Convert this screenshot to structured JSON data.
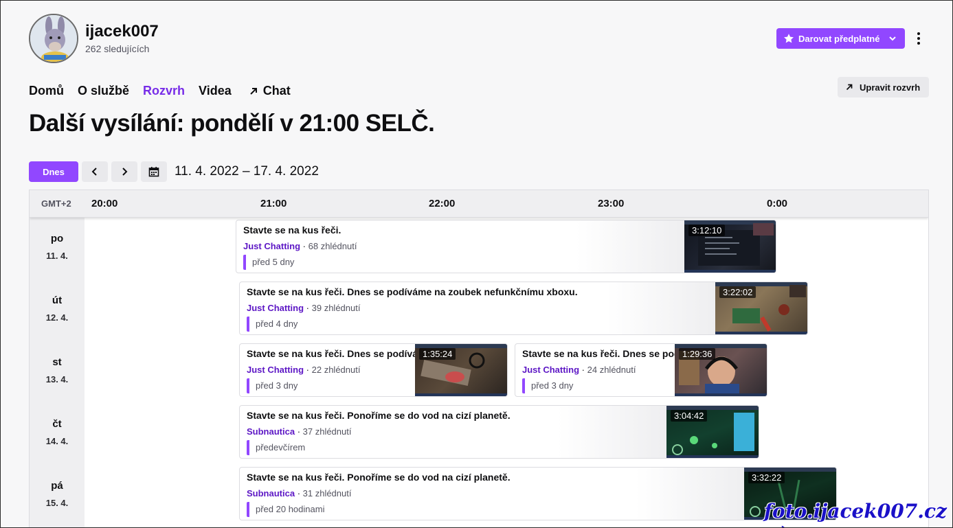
{
  "channel": {
    "name": "ijacek007",
    "followers": "262 sledujících"
  },
  "header": {
    "gift_label": "Darovat předplatné",
    "edit_label": "Upravit rozvrh"
  },
  "nav": {
    "home": "Domů",
    "about": "O službě",
    "schedule": "Rozvrh",
    "videos": "Videa",
    "chat": "Chat"
  },
  "headline": "Další vysílání: pondělí v 21:00 SELČ.",
  "controls": {
    "today": "Dnes",
    "range": "11. 4. 2022 – 17. 4. 2022"
  },
  "grid": {
    "tz": "GMT+2",
    "hours": [
      "20:00",
      "21:00",
      "22:00",
      "23:00",
      "0:00"
    ],
    "days": [
      {
        "name": "po",
        "date": "11. 4."
      },
      {
        "name": "út",
        "date": "12. 4."
      },
      {
        "name": "st",
        "date": "13. 4."
      },
      {
        "name": "čt",
        "date": "14. 4."
      },
      {
        "name": "pá",
        "date": "15. 4."
      }
    ]
  },
  "streams": [
    {
      "title": "Stavte se na kus řeči.",
      "game": "Just Chatting",
      "views": "68 zhlédnutí",
      "ago": "před 5 dny",
      "duration": "3:12:10"
    },
    {
      "title": "Stavte se na kus řeči. Dnes se podíváme na zoubek nefunkčnímu xboxu.",
      "game": "Just Chatting",
      "views": "39 zhlédnutí",
      "ago": "před 4 dny",
      "duration": "3:22:02"
    },
    {
      "title": "Stavte se na kus řeči. Dnes se podíváme",
      "game": "Just Chatting",
      "views": "22 zhlédnutí",
      "ago": "před 3 dny",
      "duration": "1:35:24"
    },
    {
      "title": "Stavte se na kus řeči. Dnes se podíváme",
      "game": "Just Chatting",
      "views": "24 zhlédnutí",
      "ago": "před 3 dny",
      "duration": "1:29:36"
    },
    {
      "title": "Stavte se na kus řeči. Ponoříme se do vod na cizí planetě.",
      "game": "Subnautica",
      "views": "37 zhlédnutí",
      "ago": "předevčírem",
      "duration": "3:04:42"
    },
    {
      "title": "Stavte se na kus řeči. Ponoříme se do vod na cizí planetě.",
      "game": "Subnautica",
      "views": "31 zhlédnutí",
      "ago": "před 20 hodinami",
      "duration": "3:32:22"
    }
  ],
  "watermark": "foto.ijacek007.cz :-)",
  "colors": {
    "accent": "#9147ff",
    "accent_text": "#772ce8",
    "game_link": "#5c16c5"
  }
}
